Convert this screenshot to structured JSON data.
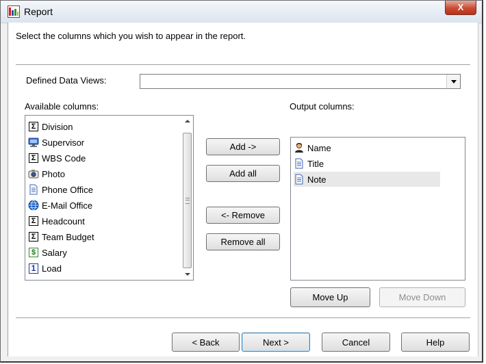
{
  "window": {
    "title": "Report",
    "close_label": "X"
  },
  "instruction": "Select the columns which you wish to appear in the report.",
  "defined_data_views": {
    "label": "Defined Data Views:",
    "value": ""
  },
  "available": {
    "label": "Available columns:",
    "items": [
      {
        "label": "Division",
        "icon": "sigma-icon"
      },
      {
        "label": "Supervisor",
        "icon": "monitor-icon"
      },
      {
        "label": "WBS Code",
        "icon": "sigma-icon"
      },
      {
        "label": "Photo",
        "icon": "camera-icon"
      },
      {
        "label": "Phone Office",
        "icon": "document-icon"
      },
      {
        "label": "E-Mail Office",
        "icon": "globe-icon"
      },
      {
        "label": "Headcount",
        "icon": "sigma-icon"
      },
      {
        "label": "Team Budget",
        "icon": "sigma-icon"
      },
      {
        "label": "Salary",
        "icon": "dollar-icon"
      },
      {
        "label": "Load",
        "icon": "number-one-icon"
      }
    ]
  },
  "output": {
    "label": "Output columns:",
    "items": [
      {
        "label": "Name",
        "icon": "person-icon"
      },
      {
        "label": "Title",
        "icon": "document-icon"
      },
      {
        "label": "Note",
        "icon": "document-icon"
      }
    ]
  },
  "buttons": {
    "add": "Add ->",
    "add_all": "Add all",
    "remove": "<- Remove",
    "remove_all": "Remove all",
    "move_up": "Move Up",
    "move_down": "Move Down",
    "back": "< Back",
    "next": "Next >",
    "cancel": "Cancel",
    "help": "Help"
  }
}
